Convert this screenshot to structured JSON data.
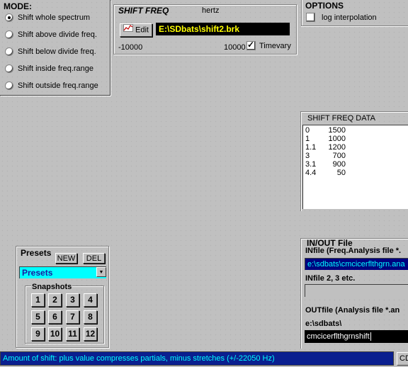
{
  "mode": {
    "title": "MODE:",
    "options": [
      {
        "label": "Shift whole spectrum",
        "selected": true
      },
      {
        "label": "Shift above divide freq.",
        "selected": false
      },
      {
        "label": "Shift  below divide freq.",
        "selected": false
      },
      {
        "label": "Shift inside freq.range",
        "selected": false
      },
      {
        "label": "Shift outside freq.range",
        "selected": false
      }
    ]
  },
  "shift": {
    "title": "SHIFT FREQ",
    "unit": "hertz",
    "edit_label": "Edit",
    "file_value": "E:\\SDbats\\shift2.brk",
    "min_label": "-10000",
    "max_label": "10000",
    "timevary_label": "Timevary",
    "timevary_checked": true
  },
  "options": {
    "title": "OPTIONS",
    "log_label": "log interpolation",
    "log_checked": false
  },
  "data_panel": {
    "title": "SHIFT FREQ  DATA",
    "rows": [
      [
        "0",
        "1500"
      ],
      [
        "1",
        "1000"
      ],
      [
        "1.1",
        "1200"
      ],
      [
        "3",
        "700"
      ],
      [
        "3.1",
        "900"
      ],
      [
        "4.4",
        "50"
      ]
    ]
  },
  "presets": {
    "title": "Presets",
    "new_label": "NEW",
    "del_label": "DEL",
    "select_value": "Presets",
    "snapshots_title": "Snapshots",
    "snapshot_buttons": [
      "1",
      "2",
      "3",
      "4",
      "5",
      "6",
      "7",
      "8",
      "9",
      "10",
      "11",
      "12"
    ]
  },
  "io": {
    "title": "IN/OUT File",
    "infile_label": "INfile (Freq.Analysis file *.",
    "infile_value": "e:\\sdbats\\cmcicerflthgrn.ana",
    "infile23_label": "INfile 2, 3 etc.",
    "infile23_value": "",
    "outfile_label": "OUTfile (Analysis file *.an",
    "outdir": "e:\\sdbats\\",
    "outfile_value": "cmcicerflthgrnshift"
  },
  "status": {
    "text": "Amount of shift: plus value compresses partials, minus stretches (+/-22050 Hz)",
    "right_label": "CD"
  },
  "colors": {
    "status_bg": "#0a1f8f",
    "field_bg": "#000000",
    "field_text": "#ffff00",
    "infile_bg": "#00007f",
    "preset_select": "#00ffff"
  }
}
